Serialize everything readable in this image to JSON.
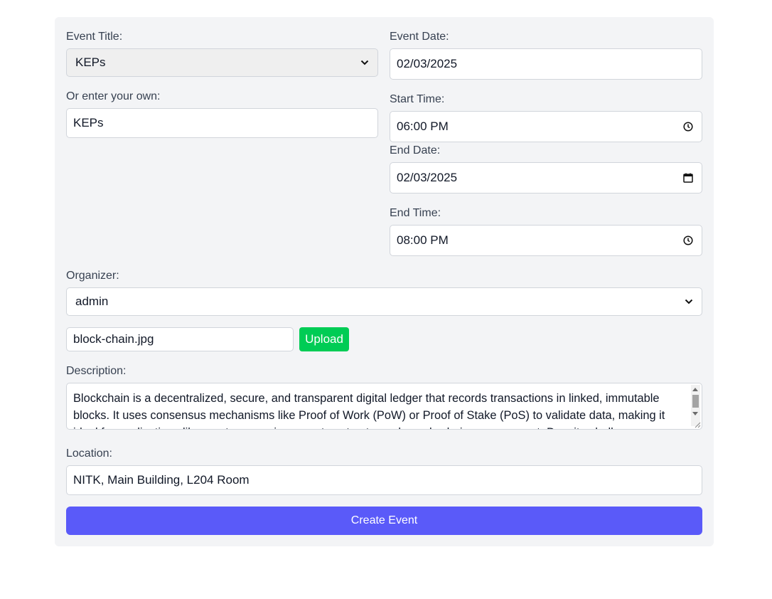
{
  "event_title": {
    "label": "Event Title:",
    "selected": "KEPs"
  },
  "custom_title": {
    "label": "Or enter your own:",
    "value": "KEPs"
  },
  "event_date": {
    "label": "Event Date:",
    "value": "02/03/2025"
  },
  "start_time": {
    "label": "Start Time:",
    "value": "06:00 PM"
  },
  "end_date": {
    "label": "End Date:",
    "value": "02/03/2025"
  },
  "end_time": {
    "label": "End Time:",
    "value": "08:00 PM"
  },
  "organizer": {
    "label": "Organizer:",
    "selected": "admin"
  },
  "image": {
    "filename": "block-chain.jpg",
    "upload_label": "Upload"
  },
  "description": {
    "label": "Description:",
    "value": "Blockchain is a decentralized, secure, and transparent digital ledger that records transactions in linked, immutable blocks. It uses consensus mechanisms like Proof of Work (PoW) or Proof of Stake (PoS) to validate data, making it ideal for applications like cryptocurrencies, smart contracts, and supply chain management. Despite challenges"
  },
  "location": {
    "label": "Location:",
    "value": "NITK, Main Building, L204 Room"
  },
  "submit": {
    "label": "Create Event"
  },
  "colors": {
    "card_bg": "#f3f4f6",
    "upload_button": "#00cc55",
    "create_button": "#5a5af9"
  }
}
